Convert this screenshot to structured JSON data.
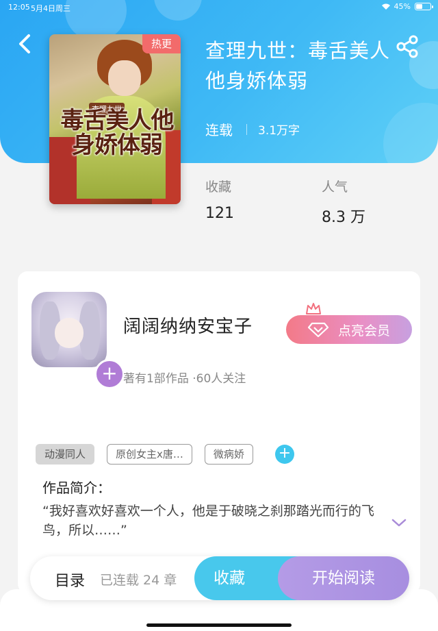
{
  "status_bar": {
    "time": "12:05",
    "date": "5月4日周三",
    "battery": "45%",
    "battery_level": 0.45
  },
  "header": {
    "back_icon": "chevron-left-icon",
    "share_icon": "share-icon"
  },
  "book": {
    "cover_art_title": "毒舌美人他身娇体弱",
    "cover_art_subtitle": "查理九世",
    "hot_tag": "热更",
    "title": "查理九世：毒舌美人他身娇体弱",
    "serial_status": "连载",
    "word_count": "3.1万字",
    "stats": {
      "favorites_label": "收藏",
      "favorites_value": "121",
      "popularity_label": "人气",
      "popularity_value": "8.3 万"
    }
  },
  "author": {
    "name": "阔阔纳纳安宝子",
    "meta": "著有1部作品 ·60人关注",
    "follow_plus": "+",
    "vip_label": "点亮会员"
  },
  "tags": {
    "items": [
      "动漫同人",
      "原创女主x唐…",
      "微病娇"
    ],
    "add": "+"
  },
  "intro": {
    "title": "作品简介：",
    "text": "“我好喜欢好喜欢一个人，他是于破晓之刹那踏光而行的飞鸟，所以……”"
  },
  "bottom_bar": {
    "toc_label": "目录",
    "chapters": "已连载 24 章",
    "favorite_label": "收藏",
    "read_label": "开始阅读"
  },
  "colors": {
    "header_blue": "#2aa6f3",
    "hot_tag": "#f26b6b",
    "favorite_button": "#48c8ec",
    "read_button": "#a78ee0",
    "avatar_plus": "#b07cd6"
  }
}
